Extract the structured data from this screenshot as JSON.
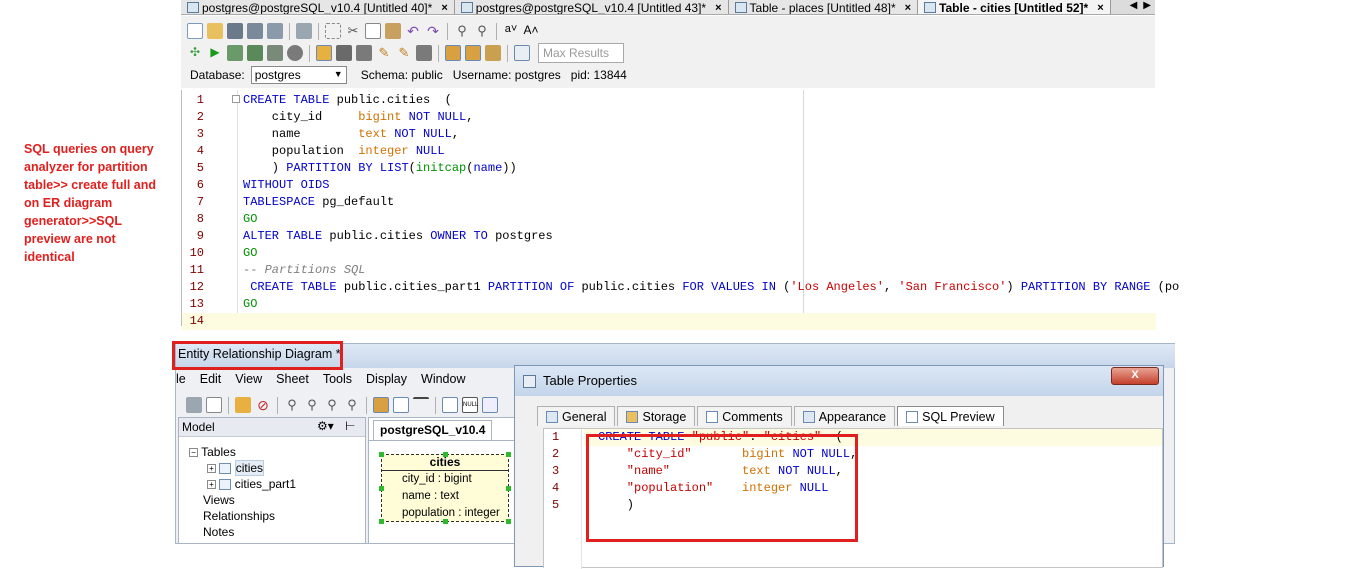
{
  "tabs": [
    {
      "label": "postgres@postgreSQL_v10.4 [Untitled 40]*",
      "active": false
    },
    {
      "label": "postgres@postgreSQL_v10.4 [Untitled 43]*",
      "active": false
    },
    {
      "label": "Table - places [Untitled 48]*",
      "active": false
    },
    {
      "label": "Table - cities [Untitled 52]*",
      "active": true
    }
  ],
  "toolbar": {
    "max_results_placeholder": "Max Results"
  },
  "dbbar": {
    "database_label": "Database:",
    "database_value": "postgres",
    "schema": "Schema:  public",
    "username": "Username:  postgres",
    "pid": "pid:  13844"
  },
  "editor_lines": [
    {
      "n": "1",
      "segs": [
        [
          "kw",
          "CREATE TABLE "
        ],
        [
          "",
          "public."
        ],
        [
          "",
          "cities  "
        ],
        [
          "",
          "("
        ]
      ]
    },
    {
      "n": "2",
      "segs": [
        [
          "",
          "    city_id     "
        ],
        [
          "ty",
          "bigint "
        ],
        [
          "kw",
          "NOT NULL"
        ],
        [
          "",
          ","
        ]
      ]
    },
    {
      "n": "3",
      "segs": [
        [
          "",
          "    name        "
        ],
        [
          "ty",
          "text "
        ],
        [
          "kw",
          "NOT NULL"
        ],
        [
          "",
          ","
        ]
      ]
    },
    {
      "n": "4",
      "segs": [
        [
          "",
          "    population  "
        ],
        [
          "ty",
          "integer "
        ],
        [
          "kw",
          "NULL"
        ]
      ]
    },
    {
      "n": "5",
      "segs": [
        [
          "",
          "    ) "
        ],
        [
          "kw",
          "PARTITION BY LIST"
        ],
        [
          "",
          "("
        ],
        [
          "fn",
          "initcap"
        ],
        [
          "",
          "("
        ],
        [
          "kw",
          "name"
        ],
        [
          "",
          "))"
        ]
      ]
    },
    {
      "n": "6",
      "segs": [
        [
          "kw",
          "WITHOUT OIDS"
        ]
      ]
    },
    {
      "n": "7",
      "segs": [
        [
          "kw",
          "TABLESPACE "
        ],
        [
          "",
          "pg_default"
        ]
      ]
    },
    {
      "n": "8",
      "segs": [
        [
          "fn",
          "GO"
        ]
      ]
    },
    {
      "n": "9",
      "segs": [
        [
          "kw",
          "ALTER TABLE "
        ],
        [
          "",
          "public.cities "
        ],
        [
          "kw",
          "OWNER TO "
        ],
        [
          "",
          "postgres"
        ]
      ]
    },
    {
      "n": "10",
      "segs": [
        [
          "fn",
          "GO"
        ]
      ]
    },
    {
      "n": "11",
      "segs": [
        [
          "cm",
          "-- Partitions SQL"
        ]
      ]
    },
    {
      "n": "12",
      "segs": [
        [
          "kw",
          " CREATE TABLE "
        ],
        [
          "",
          "public.cities_part1 "
        ],
        [
          "kw",
          "PARTITION OF "
        ],
        [
          "",
          "public.cities "
        ],
        [
          "kw",
          "FOR VALUES IN "
        ],
        [
          "",
          "("
        ],
        [
          "st",
          "'Los Angeles'"
        ],
        [
          "",
          ", "
        ],
        [
          "st",
          "'San Francisco'"
        ],
        [
          "",
          ") "
        ],
        [
          "kw",
          "PARTITION BY RANGE "
        ],
        [
          "",
          "(po"
        ]
      ]
    },
    {
      "n": "13",
      "segs": [
        [
          "fn",
          "GO"
        ]
      ]
    },
    {
      "n": "14",
      "segs": []
    }
  ],
  "annotation": "SQL queries on query analyzer for partition table>> create full and on ER diagram generator>>SQL preview are not identical",
  "er": {
    "title": "Entity Relationship Diagram *",
    "menu": [
      "le",
      "Edit",
      "View",
      "Sheet",
      "Tools",
      "Display",
      "Window"
    ],
    "model_label": "Model",
    "canvas_tab": "postgreSQL_v10.4",
    "tree": {
      "tables": "Tables",
      "cities": "cities",
      "cities_part1": "cities_part1",
      "views": "Views",
      "relationships": "Relationships",
      "notes": "Notes"
    },
    "entity": {
      "name": "cities",
      "rows": [
        "city_id : bigint",
        "name : text",
        "population : integer"
      ]
    }
  },
  "table_props": {
    "title": "Table Properties",
    "close": "X",
    "tabs": [
      "General",
      "Storage",
      "Comments",
      "Appearance",
      "SQL Preview"
    ],
    "lines": [
      {
        "n": "1",
        "segs": [
          [
            "kw",
            "CREATE TABLE "
          ],
          [
            "st",
            "\"public\""
          ],
          [
            "",
            ". "
          ],
          [
            "st",
            "\"cities\""
          ],
          [
            "",
            "  ("
          ]
        ]
      },
      {
        "n": "2",
        "segs": [
          [
            "st",
            "    \"city_id\"       "
          ],
          [
            "ty",
            "bigint "
          ],
          [
            "kw",
            "NOT NULL"
          ],
          [
            "",
            ","
          ]
        ]
      },
      {
        "n": "3",
        "segs": [
          [
            "st",
            "    \"name\"          "
          ],
          [
            "ty",
            "text "
          ],
          [
            "kw",
            "NOT NULL"
          ],
          [
            "",
            ","
          ]
        ]
      },
      {
        "n": "4",
        "segs": [
          [
            "st",
            "    \"population\"    "
          ],
          [
            "ty",
            "integer "
          ],
          [
            "kw",
            "NULL"
          ]
        ]
      },
      {
        "n": "5",
        "segs": [
          [
            "",
            "    )"
          ]
        ]
      }
    ]
  }
}
